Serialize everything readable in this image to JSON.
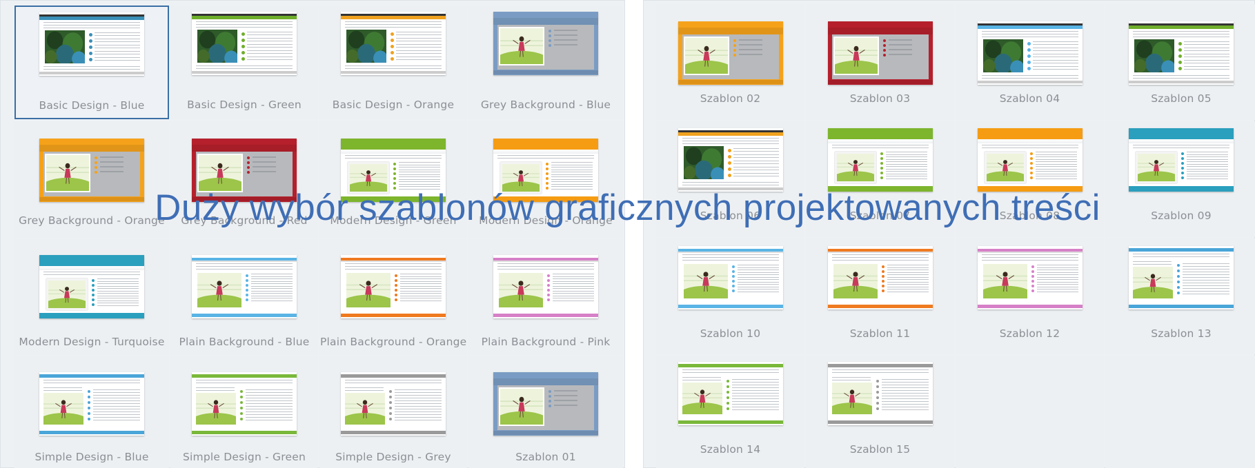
{
  "headline": "Duży wybór szablonów graficznych projektowanych treści",
  "left_panel": {
    "templates": [
      {
        "label": "Basic Design - Blue",
        "selected": true,
        "style": "basic",
        "color": "#3a8fb7"
      },
      {
        "label": "Basic Design - Green",
        "selected": false,
        "style": "basic",
        "color": "#6fae2a"
      },
      {
        "label": "Basic Design - Orange",
        "selected": false,
        "style": "basic",
        "color": "#f0a11e"
      },
      {
        "label": "Grey Background - Blue",
        "selected": false,
        "style": "grey",
        "color": "#7a9cc4"
      },
      {
        "label": "Grey Background - Orange",
        "selected": false,
        "style": "grey",
        "color": "#f5a21a"
      },
      {
        "label": "Grey Background - Red",
        "selected": false,
        "style": "grey",
        "color": "#b5202c"
      },
      {
        "label": "Modern Design - Green",
        "selected": false,
        "style": "modern",
        "color": "#7db52d"
      },
      {
        "label": "Modern Design - Orange",
        "selected": false,
        "style": "modern",
        "color": "#f59c12"
      },
      {
        "label": "Modern Design - Turquoise",
        "selected": false,
        "style": "modern",
        "color": "#2b9fbe"
      },
      {
        "label": "Plain Background - Blue",
        "selected": false,
        "style": "plain",
        "color": "#5ab4e5"
      },
      {
        "label": "Plain Background - Orange",
        "selected": false,
        "style": "plain",
        "color": "#ef7a1f"
      },
      {
        "label": "Plain Background - Pink",
        "selected": false,
        "style": "plain",
        "color": "#d680c8"
      },
      {
        "label": "Simple Design - Blue",
        "selected": false,
        "style": "simple",
        "color": "#4aa5d8"
      },
      {
        "label": "Simple Design - Green",
        "selected": false,
        "style": "simple",
        "color": "#7ab83a"
      },
      {
        "label": "Simple Design - Grey",
        "selected": false,
        "style": "simple",
        "color": "#9a9a9a"
      },
      {
        "label": "Szablon 01",
        "selected": false,
        "style": "grey",
        "color": "#7a9cc4"
      }
    ]
  },
  "right_panel": {
    "templates": [
      {
        "label": "Szablon 02",
        "selected": false,
        "style": "grey",
        "color": "#f5a21a"
      },
      {
        "label": "Szablon 03",
        "selected": false,
        "style": "grey",
        "color": "#b5202c"
      },
      {
        "label": "Szablon 04",
        "selected": false,
        "style": "basic",
        "color": "#5ab4e5"
      },
      {
        "label": "Szablon 05",
        "selected": false,
        "style": "basic",
        "color": "#6fae2a"
      },
      {
        "label": "Szablon 06",
        "selected": false,
        "style": "basic",
        "color": "#f0a11e"
      },
      {
        "label": "Szablon 07",
        "selected": false,
        "style": "modern",
        "color": "#7db52d"
      },
      {
        "label": "Szablon 08",
        "selected": false,
        "style": "modern",
        "color": "#f59c12"
      },
      {
        "label": "Szablon 09",
        "selected": false,
        "style": "modern",
        "color": "#2b9fbe"
      },
      {
        "label": "Szablon 10",
        "selected": false,
        "style": "plain",
        "color": "#5ab4e5"
      },
      {
        "label": "Szablon 11",
        "selected": false,
        "style": "plain",
        "color": "#ef7a1f"
      },
      {
        "label": "Szablon 12",
        "selected": false,
        "style": "plain",
        "color": "#d680c8"
      },
      {
        "label": "Szablon 13",
        "selected": false,
        "style": "simple",
        "color": "#4aa5d8"
      },
      {
        "label": "Szablon 14",
        "selected": false,
        "style": "simple",
        "color": "#7ab83a"
      },
      {
        "label": "Szablon 15",
        "selected": false,
        "style": "simple",
        "color": "#9a9a9a"
      }
    ]
  }
}
